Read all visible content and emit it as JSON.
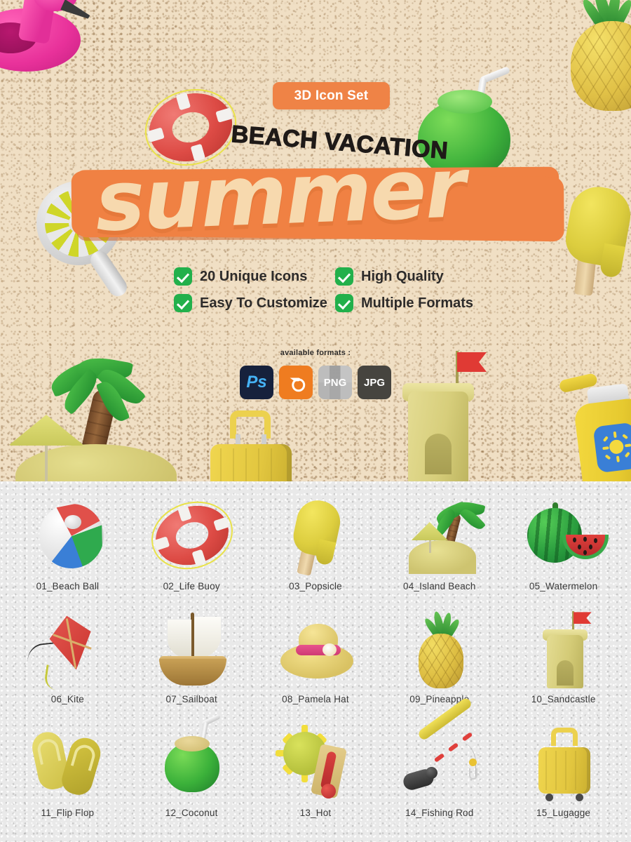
{
  "hero": {
    "badge_label": "3D Icon Set",
    "kicker": "BEACH VACATION",
    "title": "summer",
    "features": [
      {
        "label": "20 Unique Icons"
      },
      {
        "label": "High Quality"
      },
      {
        "label": "Easy To Customize"
      },
      {
        "label": "Multiple Formats"
      }
    ],
    "formats_caption": "available formats :",
    "formats": [
      {
        "label": "Ps",
        "name": "photoshop",
        "color": "#16213c",
        "text_color": "#45b2f5"
      },
      {
        "label": "",
        "name": "blender",
        "color": "#ef7c20",
        "text_color": "#ffffff"
      },
      {
        "label": "PNG",
        "name": "png",
        "color": "#b9b9b9",
        "text_color": "#ffffff"
      },
      {
        "label": "JPG",
        "name": "jpg",
        "color": "#46443f",
        "text_color": "#ffffff"
      }
    ],
    "decorations": [
      "flamingo-float",
      "life-buoy",
      "coconut-drink",
      "pineapple",
      "popsicle",
      "pinwheel",
      "palm-tree",
      "beach-umbrella",
      "suitcase",
      "sandcastle",
      "sunscreen-bottle"
    ],
    "colors": {
      "sand": "#f0dfc4",
      "accent_orange": "#ef8346",
      "banner_orange": "#f08143",
      "title_fill": "#f7d9ae",
      "check_green": "#22b04b",
      "text_dark": "#2d2b2a"
    }
  },
  "icon_grid": {
    "background": "#e9e9e9",
    "columns": 5,
    "rows": 3,
    "items": [
      {
        "num": "01",
        "label": "01_Beach Ball",
        "art": "beach-ball"
      },
      {
        "num": "02",
        "label": "02_Life Buoy",
        "art": "life-buoy"
      },
      {
        "num": "03",
        "label": "03_Popsicle",
        "art": "popsicle"
      },
      {
        "num": "04",
        "label": "04_Island Beach",
        "art": "island-beach"
      },
      {
        "num": "05",
        "label": "05_Watermelon",
        "art": "watermelon"
      },
      {
        "num": "06",
        "label": "06_Kite",
        "art": "kite"
      },
      {
        "num": "07",
        "label": "07_Sailboat",
        "art": "sailboat"
      },
      {
        "num": "08",
        "label": "08_Pamela Hat",
        "art": "pamela-hat"
      },
      {
        "num": "09",
        "label": "09_Pineapple",
        "art": "pineapple"
      },
      {
        "num": "10",
        "label": "10_Sandcastle",
        "art": "sandcastle"
      },
      {
        "num": "11",
        "label": "11_Flip Flop",
        "art": "flip-flop"
      },
      {
        "num": "12",
        "label": "12_Coconut",
        "art": "coconut"
      },
      {
        "num": "13",
        "label": "13_Hot",
        "art": "hot"
      },
      {
        "num": "14",
        "label": "14_Fishing Rod",
        "art": "fishing-rod"
      },
      {
        "num": "15",
        "label": "15_Lugagge",
        "art": "luggage"
      }
    ]
  }
}
